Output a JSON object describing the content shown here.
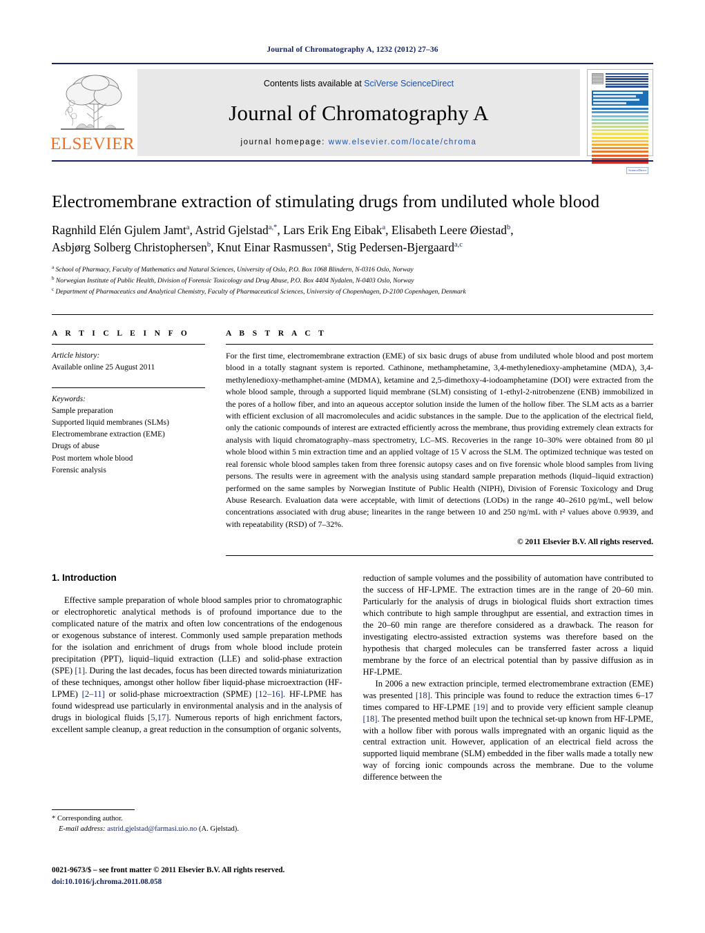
{
  "running_head": "Journal of Chromatography A, 1232 (2012) 27–36",
  "masthead": {
    "publisher_logo_text": "ELSEVIER",
    "contents_prefix": "Contents lists available at ",
    "contents_link": "SciVerse ScienceDirect",
    "journal_title": "Journal of Chromatography A",
    "homepage_prefix": "journal homepage: ",
    "homepage_url": "www.elsevier.com/locate/chroma",
    "cover_caption": "JOURNAL OF CHROMATOGRAPHY A",
    "cover_badge": "ScienceDirect"
  },
  "article": {
    "title": "Electromembrane extraction of stimulating drugs from undiluted whole blood",
    "authors_line1": "Ragnhild Elén Gjulem Jamt",
    "authors_html": "Ragnhild Elén Gjulem Jamt<sup>a</sup>, Astrid Gjelstad<sup>a,*</sup>, Lars Erik Eng Eibak<sup>a</sup>, Elisabeth Leere Øiestad<sup>b</sup>, Asbjørg Solberg Christophersen<sup>b</sup>, Knut Einar Rasmussen<sup>a</sup>, Stig Pedersen-Bjergaard<sup>a,c</sup>",
    "affiliations": [
      "a School of Pharmacy, Faculty of Mathematics and Natural Sciences, University of Oslo, P.O. Box 1068 Blindern, N-0316 Oslo, Norway",
      "b Norwegian Institute of Public Health, Division of Forensic Toxicology and Drug Abuse, P.O. Box 4404 Nydalen, N-0403 Oslo, Norway",
      "c Department of Pharmaceutics and Analytical Chemistry, Faculty of Pharmaceutical Sciences, University of Chopenhagen, D-2100 Copenhagen, Denmark"
    ]
  },
  "article_info": {
    "heading": "A R T I C L E   I N F O",
    "history_label": "Article history:",
    "history_value": "Available online 25 August 2011",
    "keywords_label": "Keywords:",
    "keywords": [
      "Sample preparation",
      "Supported liquid membranes (SLMs)",
      "Electromembrane extraction (EME)",
      "Drugs of abuse",
      "Post mortem whole blood",
      "Forensic analysis"
    ]
  },
  "abstract": {
    "heading": "A B S T R A C T",
    "text": "For the first time, electromembrane extraction (EME) of six basic drugs of abuse from undiluted whole blood and post mortem blood in a totally stagnant system is reported. Cathinone, methamphetamine, 3,4-methylenedioxy-amphetamine (MDA), 3,4-methylenedioxy-methamphet-amine (MDMA), ketamine and 2,5-dimethoxy-4-iodoamphetamine (DOI) were extracted from the whole blood sample, through a supported liquid membrane (SLM) consisting of 1-ethyl-2-nitrobenzene (ENB) immobilized in the pores of a hollow fiber, and into an aqueous acceptor solution inside the lumen of the hollow fiber. The SLM acts as a barrier with efficient exclusion of all macromolecules and acidic substances in the sample. Due to the application of the electrical field, only the cationic compounds of interest are extracted efficiently across the membrane, thus providing extremely clean extracts for analysis with liquid chromatography–mass spectrometry, LC–MS. Recoveries in the range 10–30% were obtained from 80 µl whole blood within 5 min extraction time and an applied voltage of 15 V across the SLM. The optimized technique was tested on real forensic whole blood samples taken from three forensic autopsy cases and on five forensic whole blood samples from living persons. The results were in agreement with the analysis using standard sample preparation methods (liquid–liquid extraction) performed on the same samples by Norwegian Institute of Public Health (NIPH), Division of Forensic Toxicology and Drug Abuse Research. Evaluation data were acceptable, with limit of detections (LODs) in the range 40–2610 pg/mL, well below concentrations associated with drug abuse; linearites in the range between 10 and 250 ng/mL with r² values above 0.9939, and with repeatability (RSD) of 7–32%.",
    "copyright": "© 2011 Elsevier B.V. All rights reserved."
  },
  "body": {
    "section_heading": "1. Introduction",
    "left_paragraph_1": "Effective sample preparation of whole blood samples prior to chromatographic or electrophoretic analytical methods is of profound importance due to the complicated nature of the matrix and often low concentrations of the endogenous or exogenous substance of interest. Commonly used sample preparation methods for the isolation and enrichment of drugs from whole blood include protein precipitation (PPT), liquid–liquid extraction (LLE) and solid-phase extraction (SPE) [1]. During the last decades, focus has been directed towards miniaturization of these techniques, amongst other hollow fiber liquid-phase microextraction (HF-LPME) [2–11] or solid-phase microextraction (SPME) [12–16]. HF-LPME has found widespread use particularly in environmental analysis and in the analysis of drugs in biological fluids [5,17]. Numerous reports of high enrichment factors, excellent sample cleanup, a great reduction in the consumption of organic solvents,",
    "right_paragraph_1": "reduction of sample volumes and the possibility of automation have contributed to the success of HF-LPME. The extraction times are in the range of 20–60 min. Particularly for the analysis of drugs in biological fluids short extraction times which contribute to high sample throughput are essential, and extraction times in the 20–60 min range are therefore considered as a drawback. The reason for investigating electro-assisted extraction systems was therefore based on the hypothesis that charged molecules can be transferred faster across a liquid membrane by the force of an electrical potential than by passive diffusion as in HF-LPME.",
    "right_paragraph_2": "In 2006 a new extraction principle, termed electromembrane extraction (EME) was presented [18]. This principle was found to reduce the extraction times 6–17 times compared to HF-LPME [19] and to provide very efficient sample cleanup [18]. The presented method built upon the technical set-up known from HF-LPME, with a hollow fiber with porous walls impregnated with an organic liquid as the central extraction unit. However, application of an electrical field across the supported liquid membrane (SLM) embedded in the fiber walls made a totally new way of forcing ionic compounds across the membrane. Due to the volume difference between the"
  },
  "footnotes": {
    "corresponding_author": "* Corresponding author.",
    "email_label": "E-mail address:",
    "email": "astrid.gjelstad@farmasi.uio.no",
    "email_suffix": " (A. Gjelstad).",
    "imprint": "0021-9673/$ – see front matter © 2011 Elsevier B.V. All rights reserved.",
    "doi": "doi:10.1016/j.chroma.2011.08.058"
  },
  "colors": {
    "navy": "#14235c",
    "link_blue": "#1b51a6",
    "elsevier_orange": "#eb6e23",
    "banner_gray": "#e8e8e8"
  }
}
